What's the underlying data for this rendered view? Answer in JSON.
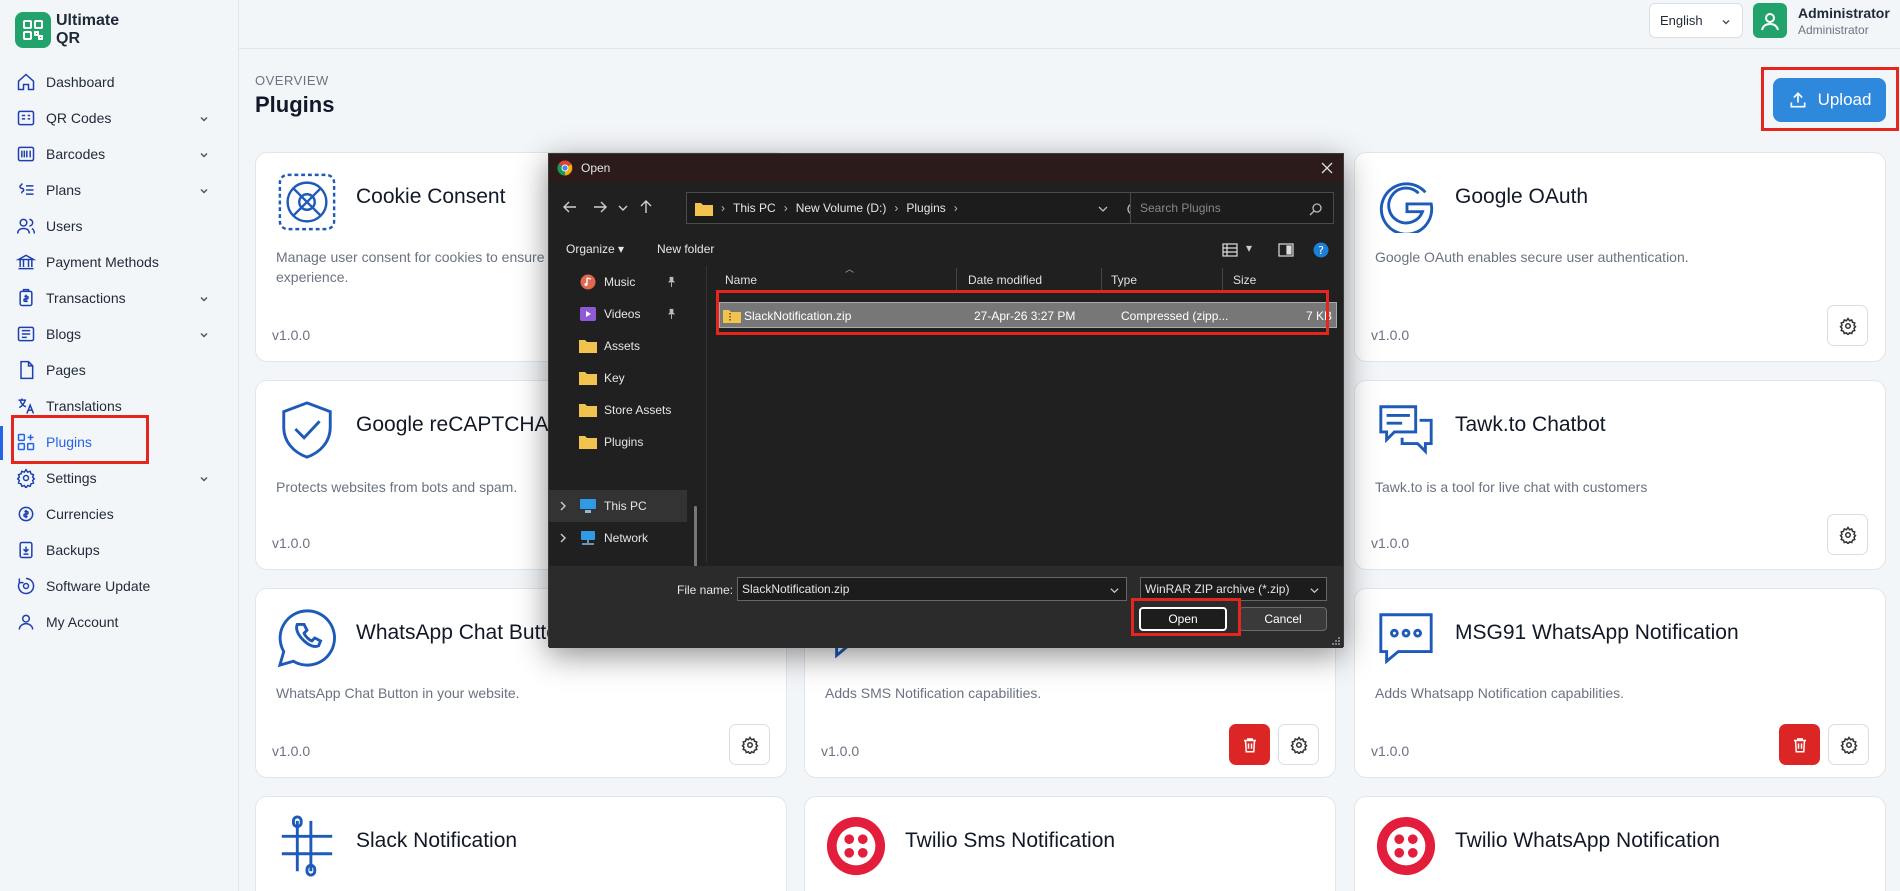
{
  "app": {
    "name": "Ultimate QR"
  },
  "sidebar": {
    "items": [
      {
        "label": "Dashboard"
      },
      {
        "label": "QR Codes"
      },
      {
        "label": "Barcodes"
      },
      {
        "label": "Plans"
      },
      {
        "label": "Users"
      },
      {
        "label": "Payment Methods"
      },
      {
        "label": "Transactions"
      },
      {
        "label": "Blogs"
      },
      {
        "label": "Pages"
      },
      {
        "label": "Translations"
      },
      {
        "label": "Plugins"
      },
      {
        "label": "Settings"
      },
      {
        "label": "Currencies"
      },
      {
        "label": "Backups"
      },
      {
        "label": "Software Update"
      },
      {
        "label": "My Account"
      }
    ]
  },
  "topbar": {
    "language": "English",
    "user_name": "Administrator",
    "user_role": "Administrator"
  },
  "header": {
    "overview": "OVERVIEW",
    "title": "Plugins",
    "upload_label": "Upload"
  },
  "plugins": [
    {
      "title": "Cookie Consent",
      "desc": "Manage user consent for cookies to ensure compliance and enhance user experience.",
      "version": "v1.0.0"
    },
    {
      "title": "Google OAuth",
      "desc": "Google OAuth enables secure user authentication.",
      "version": "v1.0.0"
    },
    {
      "title": "Google reCAPTCHA",
      "desc": "Protects websites from bots and spam.",
      "version": "v1.0.0"
    },
    {
      "title": "Tawk.to Chatbot",
      "desc": "Tawk.to is a tool for live chat with customers",
      "version": "v1.0.0"
    },
    {
      "title": "WhatsApp Chat Button",
      "desc": "WhatsApp Chat Button in your website.",
      "version": "v1.0.0"
    },
    {
      "title": "",
      "desc": "Adds SMS Notification capabilities.",
      "version": "v1.0.0"
    },
    {
      "title": "MSG91 WhatsApp Notification",
      "desc": "Adds Whatsapp Notification capabilities.",
      "version": "v1.0.0"
    },
    {
      "title": "Slack Notification",
      "desc": "",
      "version": ""
    },
    {
      "title": "Twilio Sms Notification",
      "desc": "",
      "version": ""
    },
    {
      "title": "Twilio WhatsApp Notification",
      "desc": "",
      "version": ""
    }
  ],
  "dialog": {
    "title": "Open",
    "breadcrumb": [
      "This PC",
      "New Volume (D:)",
      "Plugins"
    ],
    "search_placeholder": "Search Plugins",
    "organize": "Organize",
    "new_folder": "New folder",
    "tree": [
      {
        "label": "Music",
        "pinned": true
      },
      {
        "label": "Videos",
        "pinned": true
      },
      {
        "label": "Assets"
      },
      {
        "label": "Key"
      },
      {
        "label": "Store Assets"
      },
      {
        "label": "Plugins"
      },
      {
        "label": "This PC"
      },
      {
        "label": "Network"
      }
    ],
    "columns": [
      "Name",
      "Date modified",
      "Type",
      "Size"
    ],
    "files": [
      {
        "name": "SlackNotification.zip",
        "modified": "27-Apr-26 3:27 PM",
        "type": "Compressed (zipp...",
        "size": "7 KB"
      }
    ],
    "file_name_label": "File name:",
    "file_name_value": "SlackNotification.zip",
    "file_type": "WinRAR ZIP archive (*.zip)",
    "open_label": "Open",
    "cancel_label": "Cancel"
  },
  "colors": {
    "accent": "#2e88dc",
    "brand": "#22a36b",
    "highlight": "#e5261f",
    "danger": "#dc2626",
    "icon": "#1e5bb8"
  }
}
